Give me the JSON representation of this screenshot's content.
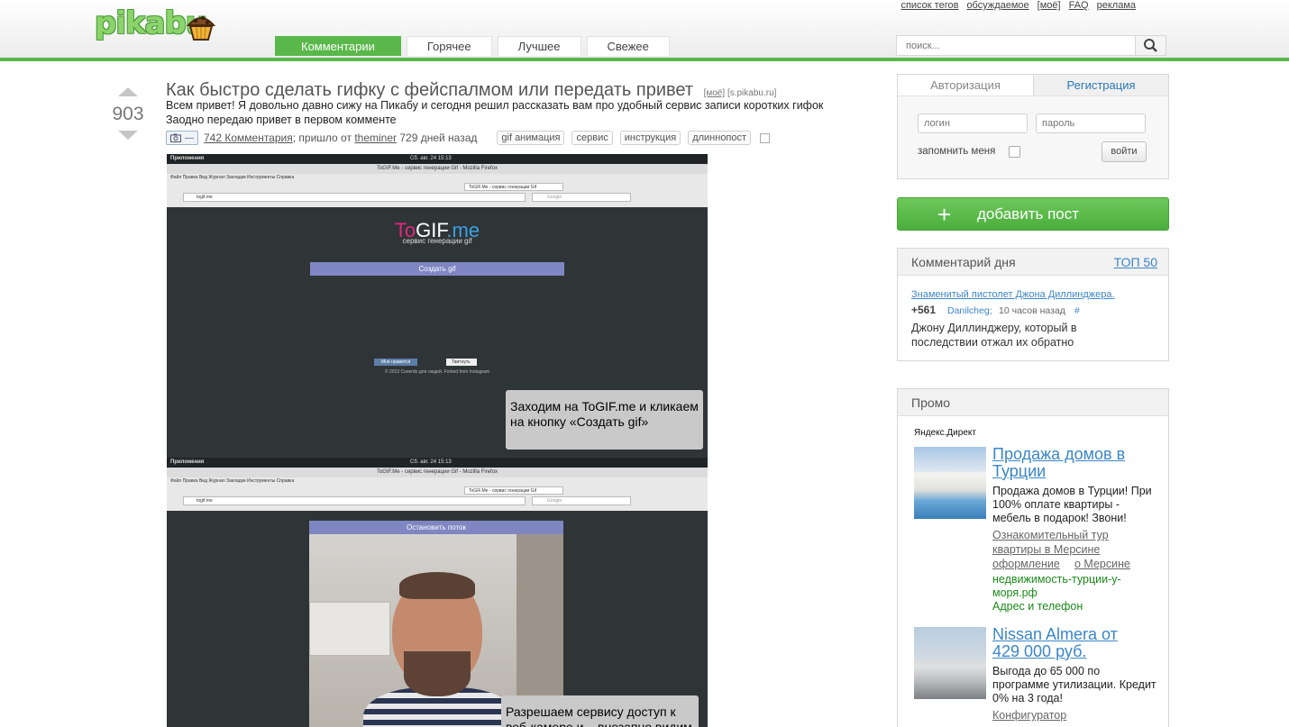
{
  "header": {
    "logo_text": "pikabu",
    "top_links": [
      "список тегов",
      "обсуждаемое",
      "[моё]",
      "FAQ",
      "реклама"
    ],
    "nav_tabs": [
      "Комментарии",
      "Горячее",
      "Лучшее",
      "Свежее"
    ],
    "active_tab": "Комментарии",
    "search_placeholder": "поиск..."
  },
  "post": {
    "rating": "903",
    "title": "Как быстро сделать гифку с фейспалмом или передать привет",
    "title_tag1": "[моё]",
    "title_tag2": "[s.pikabu.ru]",
    "description_line1": "Всем привет! Я довольно давно сижу на Пикабу и сегодня решил рассказать вам про удобный сервис записи коротких гифок",
    "description_line2": "Заодно передаю привет в первом комменте",
    "cam_label": "—",
    "comments": "742 Комментария",
    "from_text": "; пришло от",
    "author": "theminer",
    "age": "729 дней назад",
    "tags": [
      "gif анимация",
      "сервис",
      "инструкция",
      "длиннопост"
    ]
  },
  "screenshot1": {
    "apps": "Приложения",
    "clock": "Сб. авг. 24 15:13",
    "window_title": "ToGIF.Me - сервис генерации Gif - Mozilla Firefox",
    "menu": "Файл   Правка   Вид   Журнал   Закладки   Инструменты   Справка",
    "tab": "ToGIF.Me - сервис генерации Gif",
    "url": "togif.me",
    "search": "Google",
    "logo_to": "To",
    "logo_gif": "GIF",
    "logo_me": ".me",
    "subtitle": "сервис генерации gif",
    "create_button": "Создать gif",
    "like": "Мне нравится",
    "tweet": "Твитнуть",
    "copyright": "© 2013 Coverdo для людей. Forked from Instagram",
    "caption": "Заходим на ToGIF.me и кликаем на кнопку «Создать gif»"
  },
  "screenshot2": {
    "apps": "Приложения",
    "clock": "Сб. авг. 24 15:13",
    "window_title": "ToGIF.Me - сервис генерации Gif - Mozilla Firefox",
    "menu": "Файл   Правка   Вид   Журнал   Закладки   Инструменты   Справка",
    "tab": "ToGIF.Me - сервис генерации Gif",
    "url": "togif.me",
    "search": "Google",
    "stop_button": "Остановить поток",
    "caption": "Разрешаем сервису доступ к веб-камере и... внезапно видим"
  },
  "sidebar": {
    "auth_tab": "Авторизация",
    "register_tab": "Регистрация",
    "login_placeholder": "логин",
    "password_placeholder": "пароль",
    "remember": "запомнить меня",
    "login_button": "войти",
    "add_post": "добавить пост",
    "cod_title": "Комментарий дня",
    "top50": "ТОП 50",
    "cod_link": "Знаменитый пистолет Джона Диллинджера.",
    "cod_score": "+561",
    "cod_user": "Danilcheg;",
    "cod_time": "10 часов назад",
    "cod_hash": "#",
    "cod_text": "Джону Диллинджеру, который в последствии отжал их обратно",
    "promo_title": "Промо",
    "yandex": "Яндекс.Директ",
    "ad1_title": "Продажа домов в Турции",
    "ad1_text": "Продажа домов в Турции! При 100% оплате квартиры - мебель в подарок! Звони!",
    "ad1_link1": "Ознакомительный тур квартиры в Мерсине",
    "ad1_link1a": "Ознакомительный тур",
    "ad1_link1b": "квартиры в Мерсине",
    "ad1_link1c": "оформление",
    "ad1_link2": "о Мерсине",
    "ad1_domain": "недвижимость-турции-у-моря.рф",
    "ad1_contact": "Адрес и телефон",
    "ad2_title": "Nissan Almera от 429 000 руб.",
    "ad2_text": "Выгода до 65 000 по программе утилизации. Кредит 0% на 3 года!",
    "ad2_link1": "Конфигуратор"
  },
  "colors": {
    "brand_green": "#5ab84a",
    "link_blue": "#3b86c7",
    "create_button": "#7f86c2"
  }
}
